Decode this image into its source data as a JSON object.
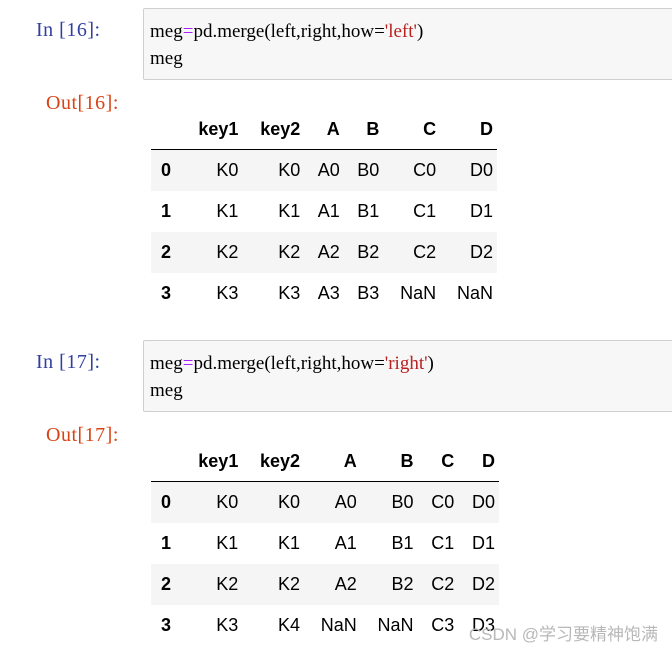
{
  "cells": [
    {
      "in_prompt": "In  [16]:",
      "code": {
        "line1": {
          "var": "meg",
          "op": "=",
          "call": "pd.merge(left,right,how=",
          "str": "'left'",
          "close": ")"
        },
        "line2": "meg"
      },
      "out_prompt": "Out[16]:",
      "table": {
        "columns": [
          "",
          "key1",
          "key2",
          "A",
          "B",
          "C",
          "D"
        ],
        "rows": [
          {
            "index": "0",
            "values": [
              "K0",
              "K0",
              "A0",
              "B0",
              "C0",
              "D0"
            ]
          },
          {
            "index": "1",
            "values": [
              "K1",
              "K1",
              "A1",
              "B1",
              "C1",
              "D1"
            ]
          },
          {
            "index": "2",
            "values": [
              "K2",
              "K2",
              "A2",
              "B2",
              "C2",
              "D2"
            ]
          },
          {
            "index": "3",
            "values": [
              "K3",
              "K3",
              "A3",
              "B3",
              "NaN",
              "NaN"
            ]
          }
        ]
      }
    },
    {
      "in_prompt": "In  [17]:",
      "code": {
        "line1": {
          "var": "meg",
          "op": "=",
          "call": "pd.merge(left,right,how=",
          "str": "'right'",
          "close": ")"
        },
        "line2": "meg"
      },
      "out_prompt": "Out[17]:",
      "table": {
        "columns": [
          "",
          "key1",
          "key2",
          "A",
          "B",
          "C",
          "D"
        ],
        "rows": [
          {
            "index": "0",
            "values": [
              "K0",
              "K0",
              "A0",
              "B0",
              "C0",
              "D0"
            ]
          },
          {
            "index": "1",
            "values": [
              "K1",
              "K1",
              "A1",
              "B1",
              "C1",
              "D1"
            ]
          },
          {
            "index": "2",
            "values": [
              "K2",
              "K2",
              "A2",
              "B2",
              "C2",
              "D2"
            ]
          },
          {
            "index": "3",
            "values": [
              "K3",
              "K4",
              "NaN",
              "NaN",
              "C3",
              "D3"
            ]
          }
        ]
      }
    }
  ],
  "watermark": "CSDN @学习要精神饱满"
}
